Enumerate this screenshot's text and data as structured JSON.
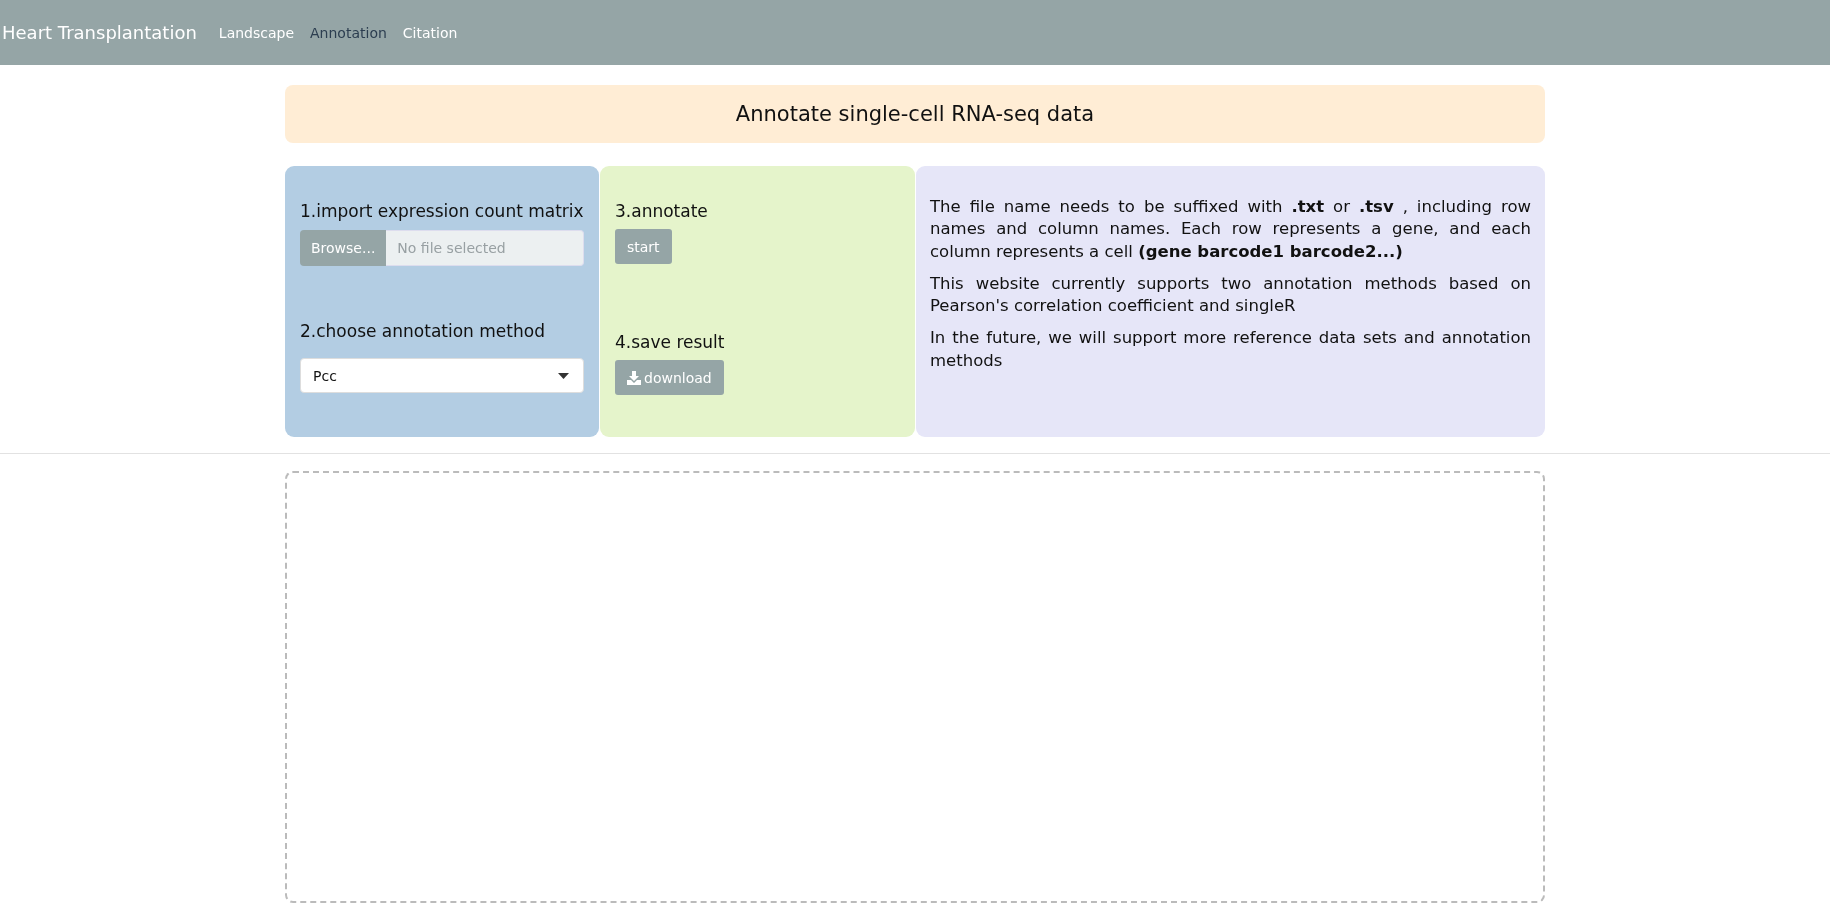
{
  "navbar": {
    "brand": "Heart Transplantation",
    "links": [
      {
        "label": "Landscape",
        "selected": false
      },
      {
        "label": "Annotation",
        "selected": true
      },
      {
        "label": "Citation",
        "selected": false
      }
    ]
  },
  "banner": {
    "title": "Annotate single-cell RNA-seq data"
  },
  "step_panel": {
    "import_label": "1.import expression count matrix",
    "browse_button": "Browse...",
    "file_placeholder": "No file selected",
    "method_label": "2.choose annotation method",
    "method_value": "Pcc"
  },
  "action_panel": {
    "annotate_label": "3.annotate",
    "start_button": "start",
    "save_label": "4.save result",
    "download_button": "download"
  },
  "info_panel": {
    "paragraphs": [
      "The file name needs to be suffixed with **.txt** or **.tsv** , including row names and column names. Each row represents a gene, and each column represents a cell **(gene barcode1 barcode2...)**",
      "This website currently supports two annotation methods based on Pearson's correlation coefficient and singleR",
      "In the future, we will support more reference data sets and annotation methods"
    ]
  }
}
